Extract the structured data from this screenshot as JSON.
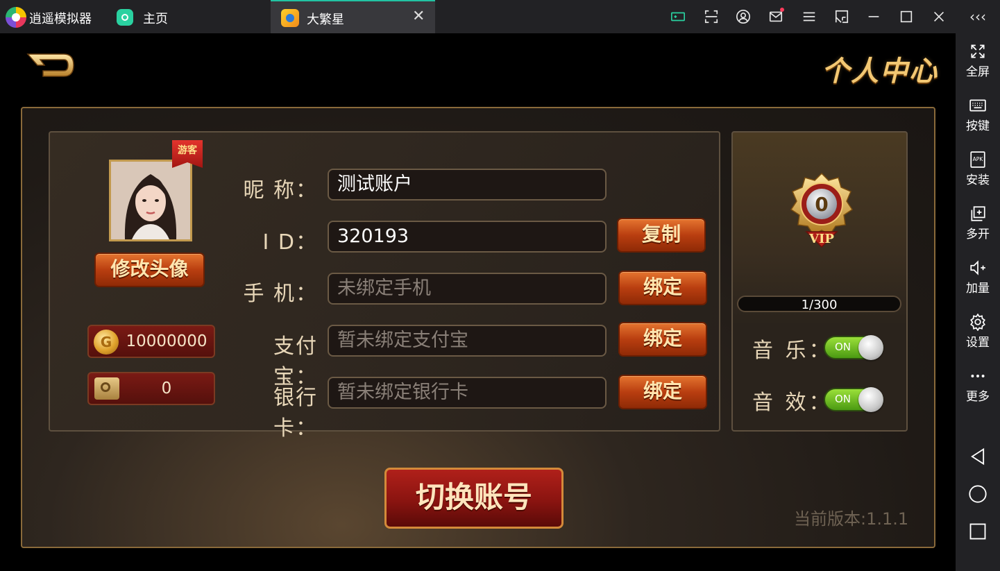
{
  "titlebar": {
    "app_name": "逍遥模拟器",
    "home_label": "主页",
    "tab_label": "大繁星",
    "tab_close": "✕"
  },
  "sidebar": {
    "collapse": "‹‹‹",
    "items": [
      {
        "label": "全屏",
        "icon": "fullscreen-icon"
      },
      {
        "label": "按键",
        "icon": "keyboard-icon"
      },
      {
        "label": "安装",
        "icon": "apk-icon"
      },
      {
        "label": "多开",
        "icon": "multi-open-icon"
      },
      {
        "label": "加量",
        "icon": "volume-up-icon"
      },
      {
        "label": "设置",
        "icon": "gear-icon"
      },
      {
        "label": "更多",
        "icon": "more-icon"
      }
    ]
  },
  "page": {
    "title": "个人中心",
    "guest_badge": "游客",
    "change_avatar": "修改头像",
    "coins": "10000000",
    "safe": "0",
    "fields": {
      "nickname_label": "昵 称：",
      "nickname_value": "测试账户",
      "id_label": "I D：",
      "id_value": "320193",
      "copy_button": "复制",
      "phone_label": "手 机：",
      "phone_placeholder": "未绑定手机",
      "phone_bind": "绑定",
      "alipay_label": "支付宝：",
      "alipay_placeholder": "暂未绑定支付宝",
      "alipay_bind": "绑定",
      "bank_label": "银行卡：",
      "bank_placeholder": "暂未绑定银行卡",
      "bank_bind": "绑定"
    },
    "vip": {
      "level": "0",
      "badge_text": "VIP",
      "progress": "1/300"
    },
    "settings": {
      "music_label": "音 乐：",
      "music_toggle": "ON",
      "sfx_label": "音 效：",
      "sfx_toggle": "ON"
    },
    "switch_account": "切换账号",
    "version": "当前版本:1.1.1"
  }
}
